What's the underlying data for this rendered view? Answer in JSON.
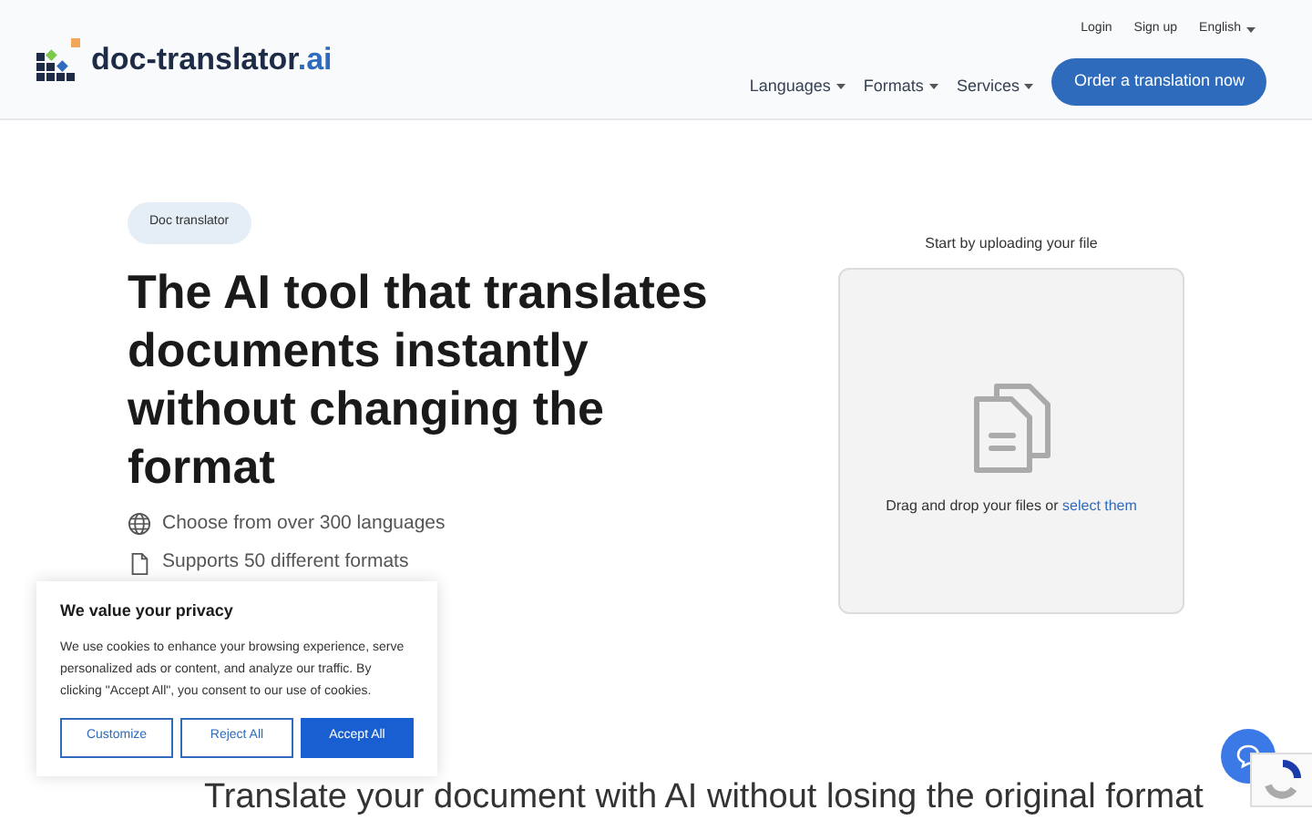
{
  "header": {
    "logo": {
      "name": "doc-translator",
      "suffix": ".ai"
    },
    "top_links": [
      {
        "label": "Login",
        "kind": "link"
      },
      {
        "label": "Sign up",
        "kind": "link"
      },
      {
        "label": "English",
        "kind": "dropdown"
      }
    ],
    "nav": [
      "Languages",
      "Formats",
      "Services"
    ],
    "cta": "Order a translation now"
  },
  "hero": {
    "badge": "Doc translator",
    "title": "The AI tool that translates documents instantly without changing the format",
    "features": [
      {
        "kind": "globe",
        "text": "Choose from over 300 languages"
      },
      {
        "kind": "file",
        "text": "Supports 50 different formats"
      }
    ]
  },
  "upload": {
    "title": "Start by uploading your file",
    "prompt": "Drag and drop your files or",
    "link": "select them"
  },
  "section_title": "Translate your document with AI without losing the original format",
  "cookie_banner": {
    "title": "We value your privacy",
    "text": "We use cookies to enhance your browsing experience, serve personalized ads or content, and analyze our traffic. By clicking \"Accept All\", you consent to our use of cookies.",
    "buttons": [
      {
        "label": "Customize",
        "kind": "outline"
      },
      {
        "label": "Reject All",
        "kind": "outline"
      },
      {
        "label": "Accept All",
        "kind": "primary"
      }
    ]
  }
}
